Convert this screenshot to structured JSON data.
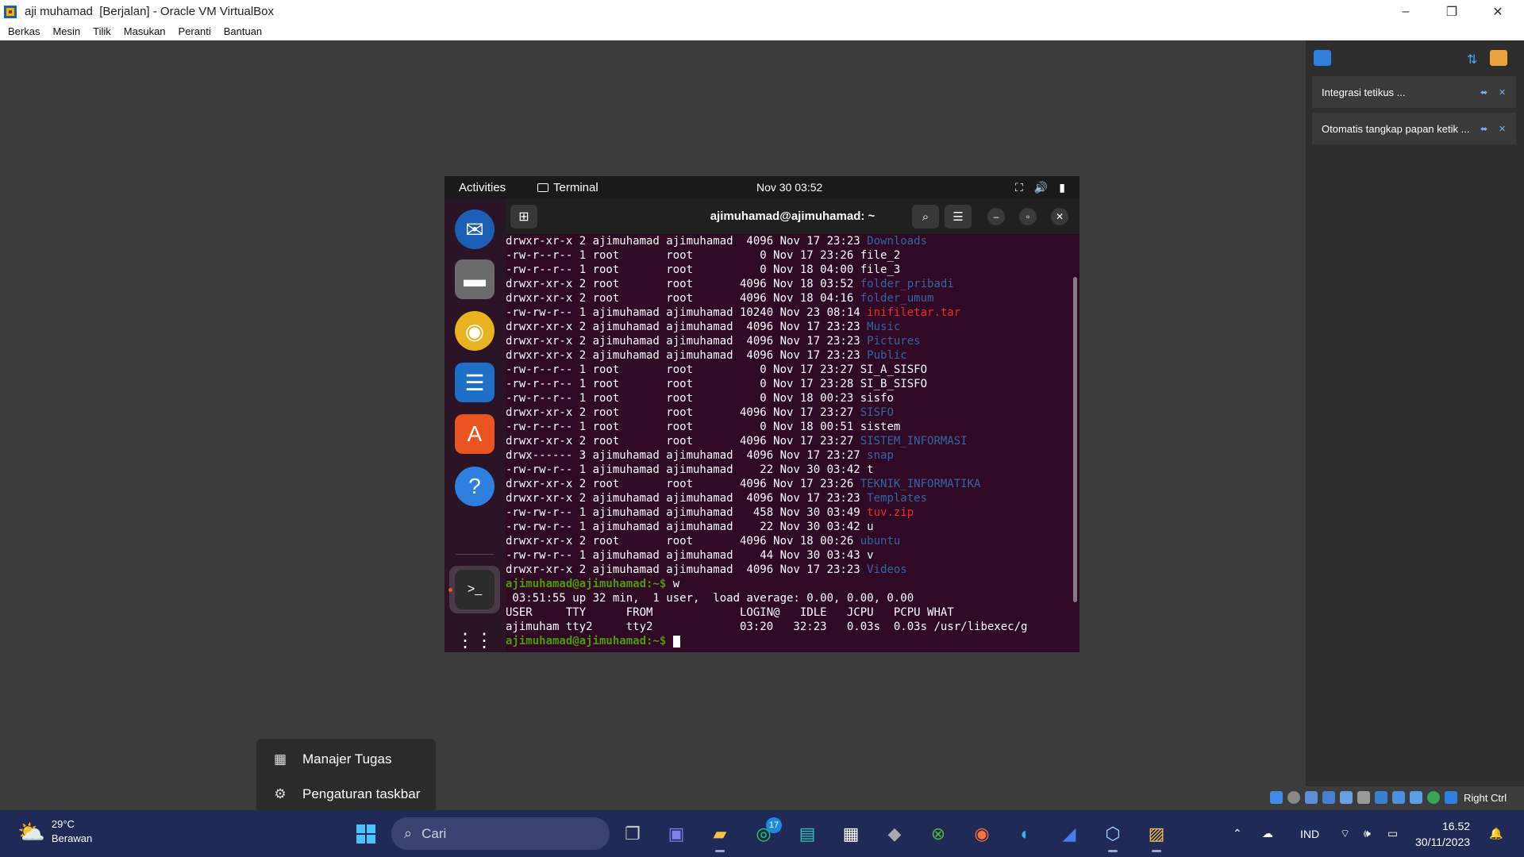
{
  "window": {
    "title": "aji muhamad  [Berjalan] - Oracle VM VirtualBox",
    "controls": {
      "minimize": "–",
      "restore": "❐",
      "close": "✕"
    }
  },
  "menubar": [
    "Berkas",
    "Mesin",
    "Tilik",
    "Masukan",
    "Peranti",
    "Bantuan"
  ],
  "side_panel": {
    "notifications": [
      {
        "label": "Integrasi tetikus ..."
      },
      {
        "label": "Otomatis tangkap papan ketik ..."
      }
    ]
  },
  "statusbar": {
    "host_key": "Right Ctrl"
  },
  "guest": {
    "topbar": {
      "activities": "Activities",
      "app_name": "Terminal",
      "clock": "Nov 30  03:52"
    },
    "terminal": {
      "title": "ajimuhamad@ajimuhamad: ~",
      "listing": [
        {
          "prefix": "drwxr-xr-x 2 ajimuhamad ajimuhamad  4096 Nov 17 23:23 ",
          "name": "Downloads",
          "kind": "dir"
        },
        {
          "prefix": "-rw-r--r-- 1 root       root          0 Nov 17 23:26 ",
          "name": "file_2",
          "kind": "file"
        },
        {
          "prefix": "-rw-r--r-- 1 root       root          0 Nov 18 04:00 ",
          "name": "file_3",
          "kind": "file"
        },
        {
          "prefix": "drwxr-xr-x 2 root       root       4096 Nov 18 03:52 ",
          "name": "folder_pribadi",
          "kind": "dir"
        },
        {
          "prefix": "drwxr-xr-x 2 root       root       4096 Nov 18 04:16 ",
          "name": "folder_umum",
          "kind": "dir"
        },
        {
          "prefix": "-rw-rw-r-- 1 ajimuhamad ajimuhamad 10240 Nov 23 08:14 ",
          "name": "inifiletar.tar",
          "kind": "arc"
        },
        {
          "prefix": "drwxr-xr-x 2 ajimuhamad ajimuhamad  4096 Nov 17 23:23 ",
          "name": "Music",
          "kind": "dir"
        },
        {
          "prefix": "drwxr-xr-x 2 ajimuhamad ajimuhamad  4096 Nov 17 23:23 ",
          "name": "Pictures",
          "kind": "dir"
        },
        {
          "prefix": "drwxr-xr-x 2 ajimuhamad ajimuhamad  4096 Nov 17 23:23 ",
          "name": "Public",
          "kind": "dir"
        },
        {
          "prefix": "-rw-r--r-- 1 root       root          0 Nov 17 23:27 ",
          "name": "SI_A_SISFO",
          "kind": "file"
        },
        {
          "prefix": "-rw-r--r-- 1 root       root          0 Nov 17 23:28 ",
          "name": "SI_B_SISFO",
          "kind": "file"
        },
        {
          "prefix": "-rw-r--r-- 1 root       root          0 Nov 18 00:23 ",
          "name": "sisfo",
          "kind": "file"
        },
        {
          "prefix": "drwxr-xr-x 2 root       root       4096 Nov 17 23:27 ",
          "name": "SISFO",
          "kind": "dir"
        },
        {
          "prefix": "-rw-r--r-- 1 root       root          0 Nov 18 00:51 ",
          "name": "sistem",
          "kind": "file"
        },
        {
          "prefix": "drwxr-xr-x 2 root       root       4096 Nov 17 23:27 ",
          "name": "SISTEM_INFORMASI",
          "kind": "dir"
        },
        {
          "prefix": "drwx------ 3 ajimuhamad ajimuhamad  4096 Nov 17 23:27 ",
          "name": "snap",
          "kind": "dir"
        },
        {
          "prefix": "-rw-rw-r-- 1 ajimuhamad ajimuhamad    22 Nov 30 03:42 ",
          "name": "t",
          "kind": "file"
        },
        {
          "prefix": "drwxr-xr-x 2 root       root       4096 Nov 17 23:26 ",
          "name": "TEKNIK_INFORMATIKA",
          "kind": "dir"
        },
        {
          "prefix": "drwxr-xr-x 2 ajimuhamad ajimuhamad  4096 Nov 17 23:23 ",
          "name": "Templates",
          "kind": "dir"
        },
        {
          "prefix": "-rw-rw-r-- 1 ajimuhamad ajimuhamad   458 Nov 30 03:49 ",
          "name": "tuv.zip",
          "kind": "arc"
        },
        {
          "prefix": "-rw-rw-r-- 1 ajimuhamad ajimuhamad    22 Nov 30 03:42 ",
          "name": "u",
          "kind": "file"
        },
        {
          "prefix": "drwxr-xr-x 2 root       root       4096 Nov 18 00:26 ",
          "name": "ubuntu",
          "kind": "dir"
        },
        {
          "prefix": "-rw-rw-r-- 1 ajimuhamad ajimuhamad    44 Nov 30 03:43 ",
          "name": "v",
          "kind": "file"
        },
        {
          "prefix": "drwxr-xr-x 2 ajimuhamad ajimuhamad  4096 Nov 17 23:23 ",
          "name": "Videos",
          "kind": "dir"
        }
      ],
      "prompt": "ajimuhamad@ajimuhamad:~$",
      "command": " w",
      "w_uptime": " 03:51:55 up 32 min,  1 user,  load average: 0.00, 0.00, 0.00",
      "w_header": "USER     TTY      FROM             LOGIN@   IDLE   JCPU   PCPU WHAT",
      "w_row": "ajimuham tty2     tty2             03:20   32:23   0.03s  0.03s /usr/libexec/g",
      "final_prompt": "ajimuhamad@ajimuhamad:~$"
    }
  },
  "context_menu": {
    "items": [
      {
        "label": "Manajer Tugas",
        "icon": "task-manager-icon"
      },
      {
        "label": "Pengaturan taskbar",
        "icon": "gear-icon"
      }
    ]
  },
  "taskbar": {
    "weather": {
      "temp": "29°C",
      "desc": "Berawan"
    },
    "search_placeholder": "Cari",
    "whatsapp_badge": "17",
    "language": "IND",
    "time": "16.52",
    "date": "30/11/2023"
  },
  "colors": {
    "terminal_bg": "#300a24",
    "dir": "#3465a4",
    "archive": "#ef2929",
    "prompt": "#4e9a06",
    "taskbar": "#202a57"
  }
}
